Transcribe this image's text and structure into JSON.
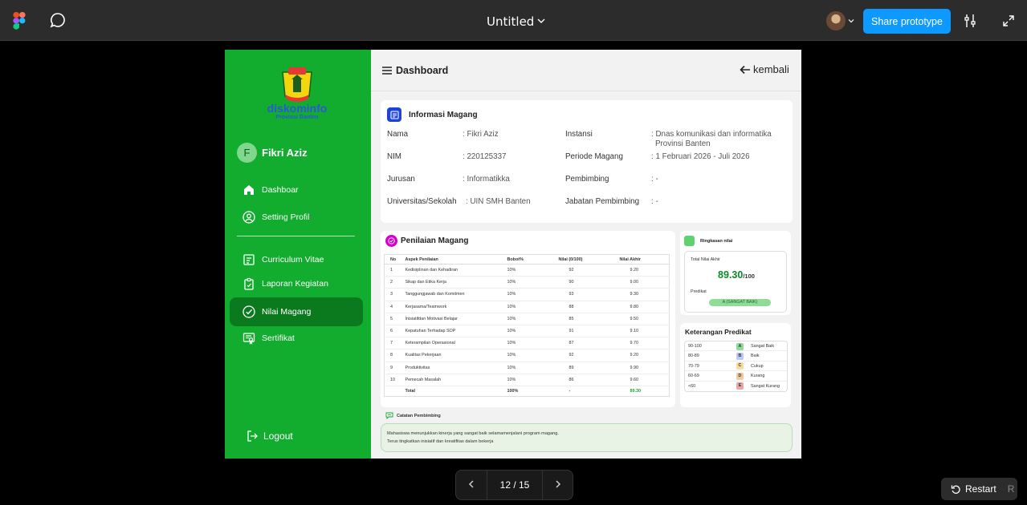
{
  "app": {
    "title": "Untitled",
    "share_label": "Share prototype",
    "colors": {
      "figma_bg": "#2c2c2c",
      "share": "#0d99ff",
      "brand_green": "#12ac2e",
      "active_green": "#0b7a1f"
    }
  },
  "sidebar": {
    "logo_text": "diskominfo",
    "logo_sub": "Provinsi Banten",
    "user_initial": "F",
    "user_name": "Fikri Aziz",
    "items": [
      {
        "label": "Dashboar",
        "icon": "home-icon"
      },
      {
        "label": "Setting Profil",
        "icon": "user-circle-icon"
      },
      {
        "label": "Curriculum Vitae",
        "icon": "cv-icon"
      },
      {
        "label": "Laporan Kegiatan",
        "icon": "clipboard-icon"
      },
      {
        "label": "Nilai Magang",
        "icon": "check-circle-icon",
        "active": true
      },
      {
        "label": "Sertifikat",
        "icon": "certificate-icon"
      }
    ],
    "logout_label": "Logout"
  },
  "header": {
    "title": "Dashboard",
    "back_label": "kembali"
  },
  "info": {
    "title": "Informasi Magang",
    "left": [
      {
        "label": "Nama",
        "value": ": Fikri Aziz"
      },
      {
        "label": "NIM",
        "value": ": 220125337"
      },
      {
        "label": "Jurusan",
        "value": ": Informatikka"
      },
      {
        "label": "Universitas/Sekolah",
        "value": ": UIN SMH Banten"
      }
    ],
    "right": [
      {
        "label": "Instansi",
        "value": ": Dnas komunikasi dan informatika",
        "value2": "Provinsi Banten"
      },
      {
        "label": "Periode Magang",
        "value": ": 1 Februari 2026 - Juli 2026"
      },
      {
        "label": "Pembimbing",
        "value": ": -"
      },
      {
        "label": "Jabatan Pembimbing",
        "value": ": -"
      }
    ]
  },
  "penilaian": {
    "title": "Penilaian Magang",
    "headers": [
      "No",
      "Aspek Penilaian",
      "Bobot%",
      "Nilai (0/100)",
      "Nilai Akhir"
    ],
    "rows": [
      [
        "1",
        "Kedisiplinan dan Kehadiran",
        "10%",
        "92",
        "9.20"
      ],
      [
        "2",
        "Sikap dan Etika Kerja",
        "10%",
        "90",
        "9.00"
      ],
      [
        "3",
        "Tanggungjawab dan Komitmen",
        "10%",
        "93",
        "9.30"
      ],
      [
        "4",
        "Kerjasama/Teamwork",
        "10%",
        "88",
        "9.80"
      ],
      [
        "5",
        "Inisiatifdan Motivasi Belajar",
        "10%",
        "85",
        "9.50"
      ],
      [
        "6",
        "Kepatuhan Terhadap SOP",
        "10%",
        "91",
        "9.10"
      ],
      [
        "7",
        "Keterampilan Operasional",
        "10%",
        "87",
        "9.70"
      ],
      [
        "8",
        "Kualitas Pekerjaan",
        "10%",
        "92",
        "9.20"
      ],
      [
        "9",
        "Produktivitas",
        "10%",
        "89",
        "9.90"
      ],
      [
        "10",
        "Pemecah Masalah",
        "10%",
        "86",
        "9.60"
      ]
    ],
    "total": [
      "",
      "Total",
      "100%",
      "-",
      "89.30"
    ]
  },
  "ringkasan": {
    "title": "Ringkasan nilai",
    "total_label": "Total Nilai Akhir",
    "score": "89.30",
    "score_max": "/100",
    "predikat_label": "Predikat",
    "predikat": "A (SANGAT BAIK)"
  },
  "keterangan": {
    "title": "Keterangan Predikat",
    "rows": [
      {
        "range": "90-100",
        "grade": "A",
        "name": "Sangat Baik",
        "color": "#8fdc97"
      },
      {
        "range": "80-89",
        "grade": "B",
        "name": "Baik",
        "color": "#b9c8f5"
      },
      {
        "range": "70-79",
        "grade": "C",
        "name": "Cukup",
        "color": "#f5dca0"
      },
      {
        "range": "60-69",
        "grade": "D",
        "name": "Kurang",
        "color": "#f5c9a0"
      },
      {
        "range": "<60",
        "grade": "E",
        "name": "Sangat Kurang",
        "color": "#f0a3a3"
      }
    ]
  },
  "catatan": {
    "title": "Catatan Pembimbing",
    "line1": "Mahasiswa menunjukkan kinerja yang sangat baik selamamenjalani program magang.",
    "line2": "Terus tingkatkan inisiatif dan kreatifitas dalam bekerja"
  },
  "pager": {
    "label": "12 / 15"
  },
  "restart": {
    "label": "Restart",
    "key": "R"
  }
}
